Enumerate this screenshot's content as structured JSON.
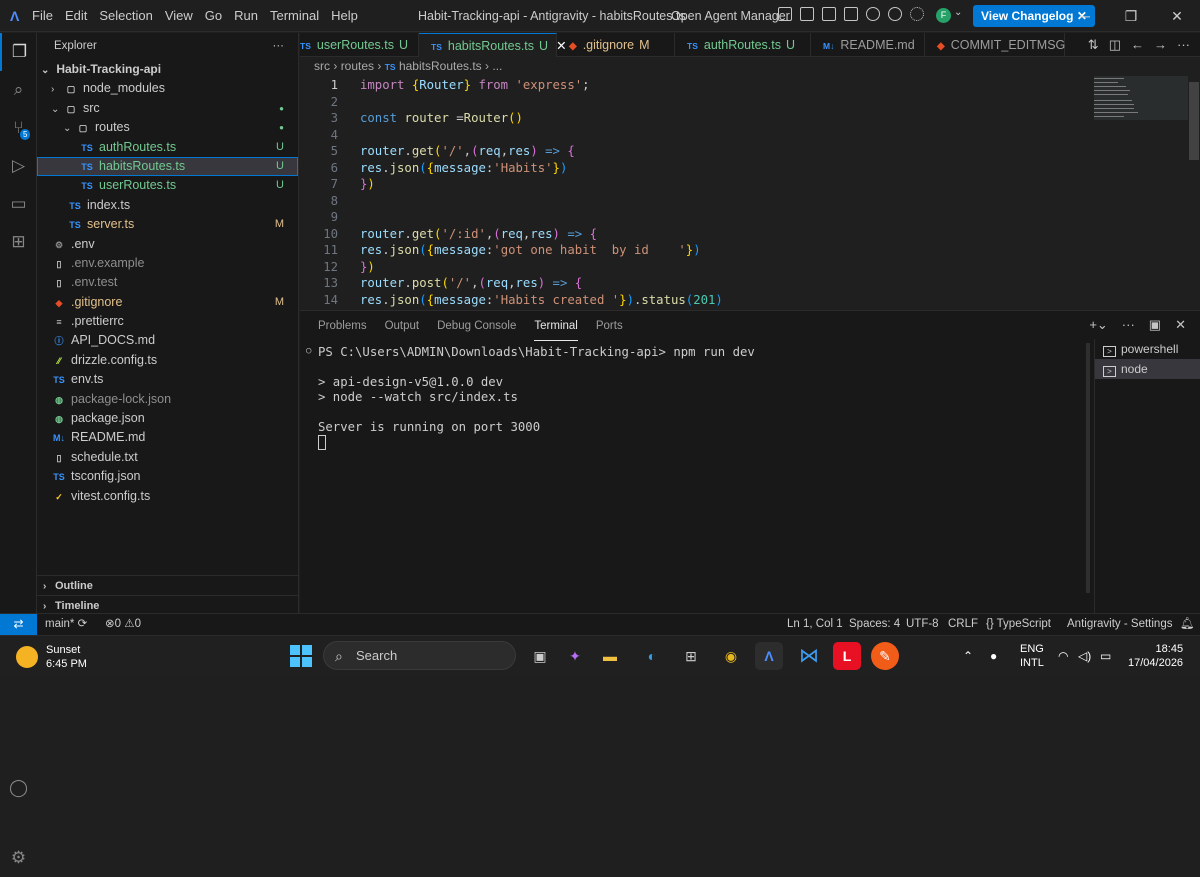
{
  "titlebar": {
    "menu": [
      "File",
      "Edit",
      "Selection",
      "View",
      "Go",
      "Run",
      "Terminal",
      "Help"
    ],
    "title": "Habit-Tracking-api - Antigravity - habitsRoutes.ts",
    "agent_manager": "Open Agent Manager",
    "changelog": "View Changelog",
    "avatar_letter": "F"
  },
  "activity": {
    "scm_badge": "5"
  },
  "explorer": {
    "header": "Explorer",
    "root": "Habit-Tracking-api",
    "items": [
      {
        "label": "node_modules",
        "icon": "folder"
      },
      {
        "label": "src",
        "icon": "folder"
      },
      {
        "label": "routes",
        "icon": "folder"
      },
      {
        "label": "authRoutes.ts",
        "icon": "TS",
        "status": "U"
      },
      {
        "label": "habitsRoutes.ts",
        "icon": "TS",
        "status": "U"
      },
      {
        "label": "userRoutes.ts",
        "icon": "TS",
        "status": "U"
      },
      {
        "label": "index.ts",
        "icon": "TS"
      },
      {
        "label": "server.ts",
        "icon": "TS",
        "status": "M"
      },
      {
        "label": ".env",
        "icon": "gear"
      },
      {
        "label": ".env.example",
        "icon": "file"
      },
      {
        "label": ".env.test",
        "icon": "file"
      },
      {
        "label": ".gitignore",
        "icon": "git",
        "status": "M"
      },
      {
        "label": ".prettierrc",
        "icon": "prettier"
      },
      {
        "label": "API_DOCS.md",
        "icon": "info"
      },
      {
        "label": "drizzle.config.ts",
        "icon": "drizzle"
      },
      {
        "label": "env.ts",
        "icon": "TS"
      },
      {
        "label": "package-lock.json",
        "icon": "npm"
      },
      {
        "label": "package.json",
        "icon": "npm"
      },
      {
        "label": "README.md",
        "icon": "M+"
      },
      {
        "label": "schedule.txt",
        "icon": "file"
      },
      {
        "label": "tsconfig.json",
        "icon": "TS"
      },
      {
        "label": "vitest.config.ts",
        "icon": "vitest"
      }
    ],
    "outline": "Outline",
    "timeline": "Timeline"
  },
  "tabs": [
    {
      "label": "userRoutes.ts",
      "icon": "TS",
      "status": "U"
    },
    {
      "label": "habitsRoutes.ts",
      "icon": "TS",
      "status": "U"
    },
    {
      "label": ".gitignore",
      "icon": "◆",
      "status": "M"
    },
    {
      "label": "authRoutes.ts",
      "icon": "TS",
      "status": "U"
    },
    {
      "label": "README.md",
      "icon": "M↓",
      "status": ""
    },
    {
      "label": "COMMIT_EDITMSG",
      "icon": "◆",
      "status": ""
    }
  ],
  "breadcrumb": [
    "src",
    "routes",
    "habitsRoutes.ts",
    "..."
  ],
  "editor": {
    "line_numbers": [
      "1",
      "2",
      "3",
      "4",
      "5",
      "6",
      "7",
      "8",
      "9",
      "10",
      "11",
      "12",
      "13",
      "14"
    ]
  },
  "panel": {
    "tabs": [
      "Problems",
      "Output",
      "Debug Console",
      "Terminal",
      "Ports"
    ],
    "terminal_lines": [
      "PS C:\\Users\\ADMIN\\Downloads\\Habit-Tracking-api> npm run dev",
      "",
      "> api-design-v5@1.0.0 dev",
      "> node --watch src/index.ts",
      "",
      "Server is running on port 3000"
    ],
    "terminals": [
      "powershell",
      "node"
    ]
  },
  "status": {
    "branch": "main*",
    "errors": "0",
    "warnings": "0",
    "position": "Ln 1, Col 1",
    "spaces": "Spaces: 4",
    "encoding": "UTF-8",
    "eol": "CRLF",
    "language": "{} TypeScript",
    "settings": "Antigravity - Settings"
  },
  "taskbar": {
    "weather_title": "Sunset",
    "weather_time": "6:45 PM",
    "search": "Search",
    "lang1": "ENG",
    "lang2": "INTL",
    "time": "18:45",
    "date": "17/04/2026"
  }
}
